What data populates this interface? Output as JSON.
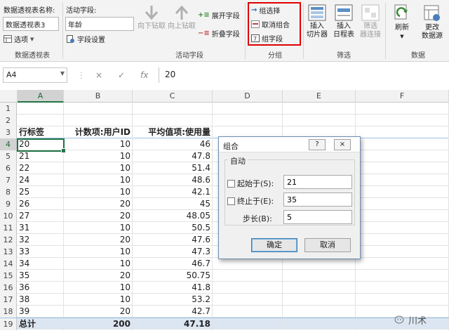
{
  "ribbon": {
    "pivot_name_label": "数据透视表名称:",
    "pivot_name_value": "数据透视表3",
    "options_label": "选项",
    "active_field_label": "活动字段:",
    "active_field_value": "年龄",
    "field_settings_label": "字段设置",
    "drill_down_label": "向下钻取",
    "drill_up_label": "向上钻取",
    "expand_field_label": "展开字段",
    "collapse_field_label": "折叠字段",
    "group_selection_label": "组选择",
    "ungroup_label": "取消组合",
    "group_field_label": "组字段",
    "insert_slicer_label": "插入\n切片器",
    "insert_slicer_l1": "插入",
    "insert_slicer_l2": "切片器",
    "insert_timeline_l1": "插入",
    "insert_timeline_l2": "日程表",
    "filter_connections_l1": "筛选",
    "filter_connections_l2": "器连接",
    "refresh_label": "刷新",
    "change_source_l1": "更改",
    "change_source_l2": "数据源",
    "groups": {
      "pivot": "数据透视表",
      "active_field": "活动字段",
      "group": "分组",
      "filter": "筛选",
      "data": "数据"
    }
  },
  "formula_bar": {
    "name_box": "A4",
    "cancel_icon": "×",
    "enter_icon": "✓",
    "fx_icon": "fx",
    "value": "20"
  },
  "columns": [
    "A",
    "B",
    "C",
    "D",
    "E",
    "F"
  ],
  "header_row": {
    "row": "3",
    "a": "行标签",
    "b": "计数项:用户ID",
    "c": "平均值项:使用量"
  },
  "data_rows": [
    {
      "row": "4",
      "a": "20",
      "b": "10",
      "c": "46"
    },
    {
      "row": "5",
      "a": "21",
      "b": "10",
      "c": "47.8"
    },
    {
      "row": "6",
      "a": "22",
      "b": "10",
      "c": "51.4"
    },
    {
      "row": "7",
      "a": "24",
      "b": "10",
      "c": "48.6"
    },
    {
      "row": "8",
      "a": "25",
      "b": "10",
      "c": "42.1"
    },
    {
      "row": "9",
      "a": "26",
      "b": "20",
      "c": "45"
    },
    {
      "row": "10",
      "a": "27",
      "b": "20",
      "c": "48.05"
    },
    {
      "row": "11",
      "a": "31",
      "b": "10",
      "c": "50.5"
    },
    {
      "row": "12",
      "a": "32",
      "b": "20",
      "c": "47.6"
    },
    {
      "row": "13",
      "a": "33",
      "b": "10",
      "c": "47.3"
    },
    {
      "row": "14",
      "a": "34",
      "b": "10",
      "c": "46.7"
    },
    {
      "row": "15",
      "a": "35",
      "b": "20",
      "c": "50.75"
    },
    {
      "row": "16",
      "a": "36",
      "b": "10",
      "c": "41.8"
    },
    {
      "row": "17",
      "a": "38",
      "b": "10",
      "c": "53.2"
    },
    {
      "row": "18",
      "a": "39",
      "b": "20",
      "c": "42.7"
    }
  ],
  "total_row": {
    "row": "19",
    "a": "总计",
    "b": "200",
    "c": "47.18"
  },
  "empty_rows": [
    "1",
    "2"
  ],
  "dialog": {
    "title": "组合",
    "help_label": "?",
    "close_label": "×",
    "section_label": "自动",
    "start_label": "起始于(S):",
    "start_value": "21",
    "end_label": "终止于(E):",
    "end_value": "35",
    "step_label": "步长(B):",
    "step_value": "5",
    "ok_label": "确定",
    "cancel_label": "取消"
  },
  "watermark": "川术",
  "colors": {
    "accent": "#217346",
    "highlight_border": "#e00000",
    "total_fill": "#dce6f2"
  }
}
